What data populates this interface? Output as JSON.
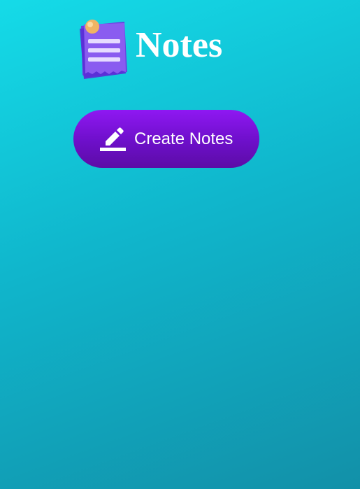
{
  "header": {
    "title": "Notes",
    "logo_icon": "notes-pad-icon"
  },
  "actions": {
    "create_label": "Create Notes",
    "create_icon": "pencil-edit-icon"
  },
  "colors": {
    "background_start": "#15dbe8",
    "background_end": "#1290a8",
    "button_start": "#8f18f2",
    "button_end": "#5c0ca6",
    "logo_paper": "#8a5cf0",
    "pin": "#f0b463"
  }
}
